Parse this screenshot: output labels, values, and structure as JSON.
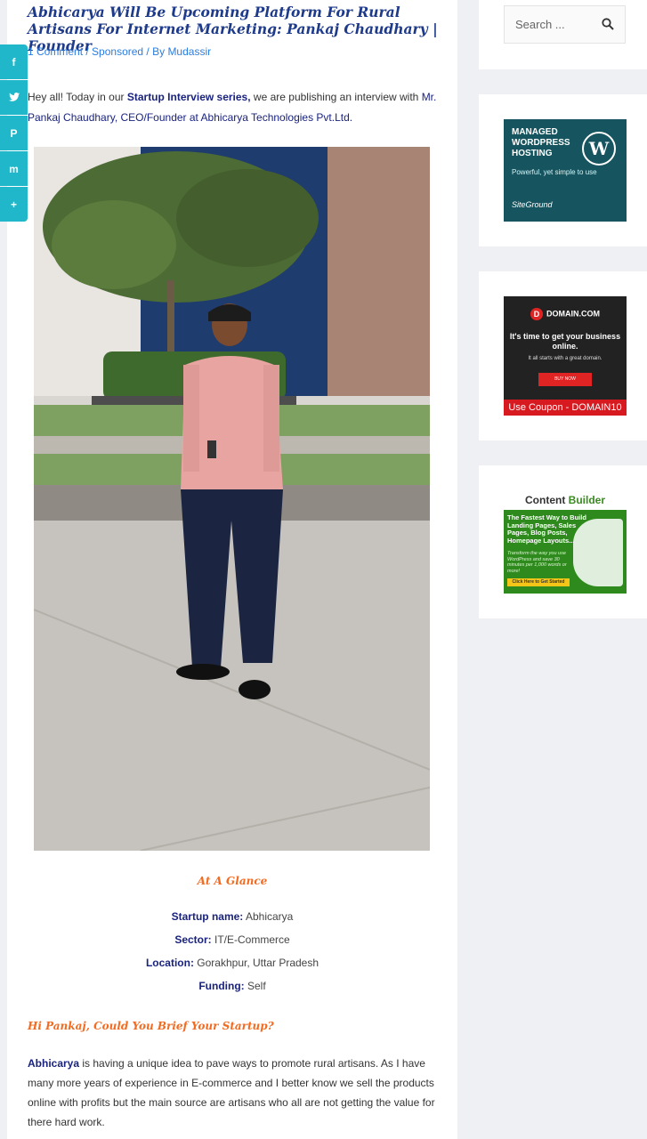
{
  "article": {
    "title": "Abhicarya Will Be Upcoming Platform For Rural Artisans For Internet Marketing: Pankaj Chaudhary | Founder",
    "meta": {
      "comments": "1 Comment",
      "separator1": " / ",
      "category": "Sponsored",
      "separator2": " / By ",
      "author": "Mudassir"
    },
    "intro": {
      "part1": "Hey all! Today in our ",
      "link": "Startup Interview series,",
      "part2": " we are publishing an interview with ",
      "name": "Mr. Pankaj Chaudhary, CEO/Founder at Abhicarya Technologies Pvt.Ltd."
    },
    "glance_heading": "At A Glance",
    "facts": [
      {
        "label": "Startup name:",
        "value": " Abhicarya"
      },
      {
        "label": "Sector:",
        "value": " IT/E-Commerce"
      },
      {
        "label": "Location:",
        "value": " Gorakhpur, Uttar Pradesh"
      },
      {
        "label": "Funding:",
        "value": " Self"
      }
    ],
    "question": "Hi Pankaj, Could You Brief Your Startup?",
    "answer": {
      "bold": "Abhicarya",
      "text": " is having a unique idea to pave ways to promote rural artisans. As I have many more years of experience in E-commerce and I better know we sell the products online with profits but the main source are artisans who all are not getting the value for there hard work."
    }
  },
  "share": {
    "buttons": [
      {
        "icon": "facebook-icon",
        "glyph": "f"
      },
      {
        "icon": "twitter-icon",
        "glyph": "t"
      },
      {
        "icon": "pinterest-icon",
        "glyph": "P"
      },
      {
        "icon": "mix-icon",
        "glyph": "m"
      },
      {
        "icon": "plus-icon",
        "glyph": "+"
      }
    ]
  },
  "sidebar": {
    "search_placeholder": "Search ...",
    "ads": {
      "siteground": {
        "title": "MANAGED WORDPRESS HOSTING",
        "tagline": "Powerful, yet simple to use",
        "brand": "SiteGround"
      },
      "domain": {
        "logo": "DOMAIN.COM",
        "headline": "It's time to get your business online.",
        "sub": "It all starts with a great domain.",
        "button": "BUY NOW",
        "coupon": "Use Coupon - DOMAIN10"
      },
      "contentbuilder": {
        "brand_a": "Content",
        "brand_b": " Builder",
        "headline": "The Fastest Way to Build Landing Pages, Sales Pages, Blog Posts, Homepage Layouts...",
        "sub": "Transform the way you use WordPress and save 30 minutes per 1,000 words or more!",
        "cta": "Click Here to Get Started"
      }
    }
  },
  "colors": {
    "title": "#1e3a8a",
    "link": "#2a7de1",
    "accent_orange": "#f26b21",
    "share_bar": "#1fb7c9"
  }
}
